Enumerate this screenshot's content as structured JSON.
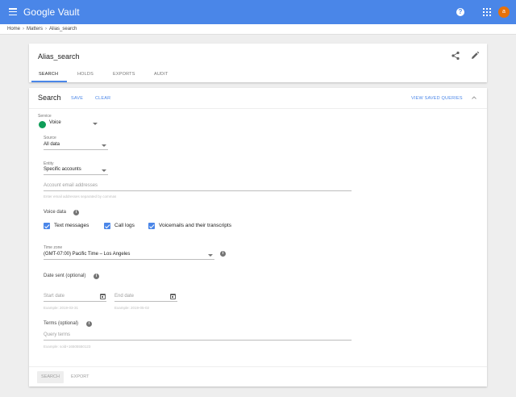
{
  "header": {
    "app_title": "Google Vault",
    "avatar_initial": "a",
    "colors": {
      "bar": "#4a86e8",
      "avatar": "#e8710a",
      "accent": "#4a86e8"
    },
    "icons": [
      "menu-icon",
      "help-icon",
      "apps-icon"
    ]
  },
  "breadcrumb": {
    "items": [
      "Home",
      "Matters",
      "Alias_search"
    ]
  },
  "matter": {
    "title": "Alias_search",
    "tabs": [
      "SEARCH",
      "HOLDS",
      "EXPORTS",
      "AUDIT"
    ],
    "active_tab": "SEARCH"
  },
  "search": {
    "title": "Search",
    "save_label": "SAVE",
    "clear_label": "CLEAR",
    "view_saved_label": "VIEW SAVED QUERIES",
    "service": {
      "label": "Service",
      "value": "Voice"
    },
    "source": {
      "label": "Source",
      "value": "All data"
    },
    "entity": {
      "label": "Entity",
      "value": "Specific accounts"
    },
    "accounts": {
      "placeholder": "Account email addresses",
      "hint": "Enter email addresses separated by commas"
    },
    "voice_data": {
      "label": "Voice data",
      "options": [
        "Text messages",
        "Call logs",
        "Voicemails and their transcripts"
      ]
    },
    "time_zone": {
      "label": "Time zone",
      "value": "(GMT-07:00) Pacific Time – Los Angeles"
    },
    "date_sent": {
      "label": "Date sent (optional)",
      "start_placeholder": "Start date",
      "start_hint": "Example: 2019-03-31",
      "end_placeholder": "End date",
      "end_hint": "Example: 2019-05-02"
    },
    "terms": {
      "label": "Terms (optional)",
      "placeholder": "Query terms",
      "hint": "Example: sold+16505550123"
    },
    "search_button": "SEARCH",
    "export_button": "EXPORT"
  }
}
